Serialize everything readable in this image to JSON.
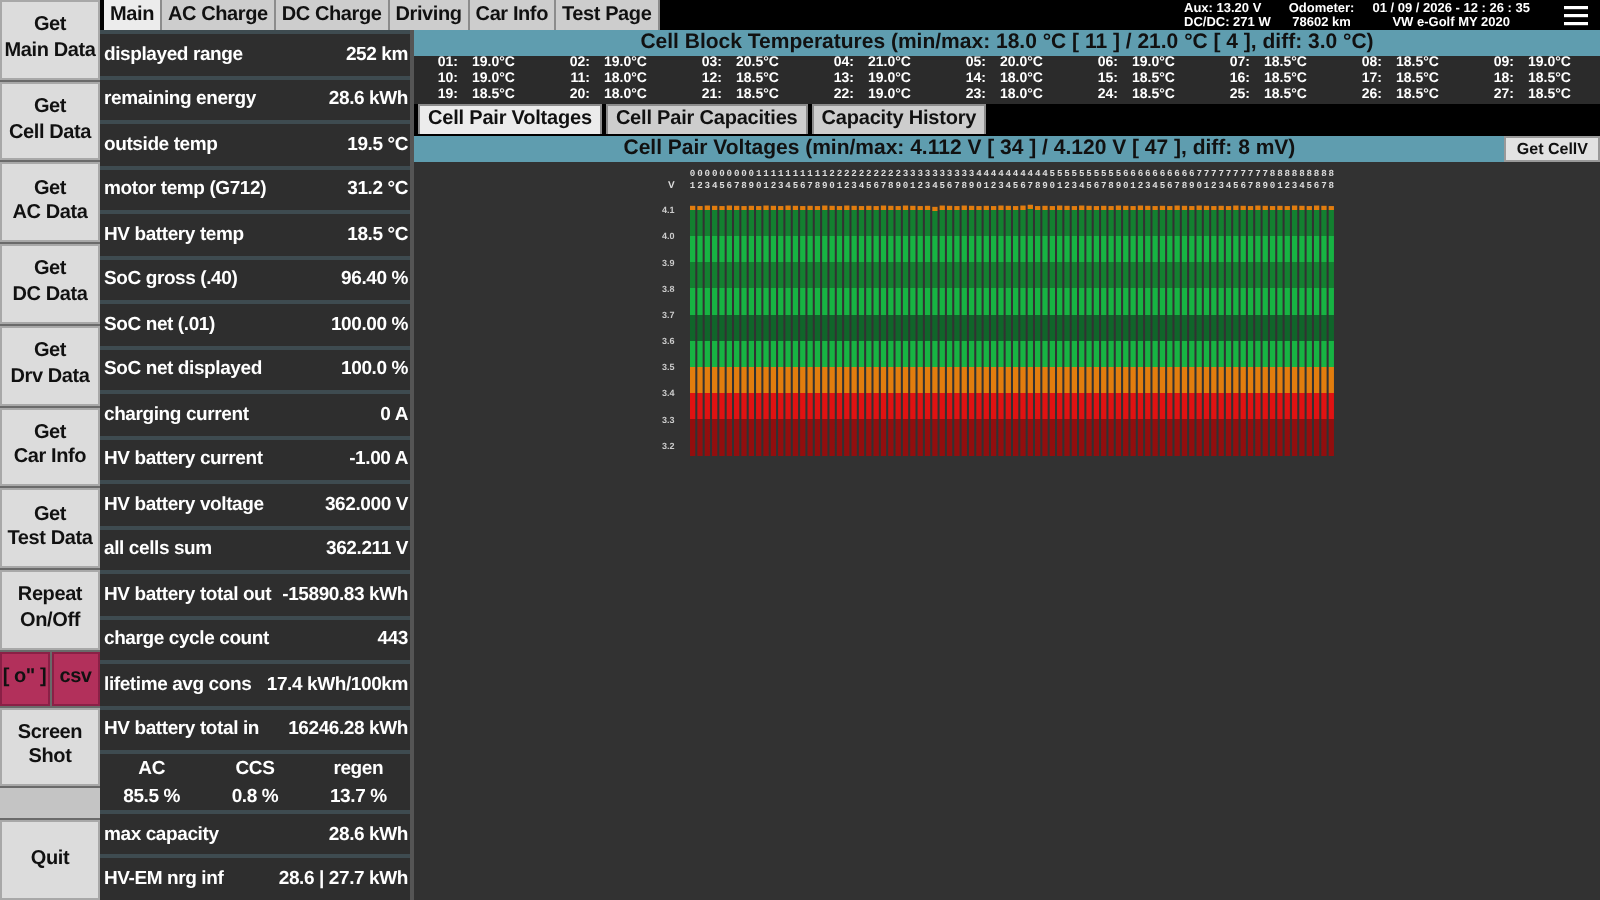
{
  "nav_buttons": [
    {
      "kind": "button",
      "lines": [
        "Get",
        "Main Data"
      ]
    },
    {
      "kind": "button",
      "lines": [
        "Get",
        "Cell Data"
      ]
    },
    {
      "kind": "button",
      "lines": [
        "Get",
        "AC Data"
      ]
    },
    {
      "kind": "button",
      "lines": [
        "Get",
        "DC Data"
      ]
    },
    {
      "kind": "button",
      "lines": [
        "Get",
        "Drv Data"
      ]
    },
    {
      "kind": "button",
      "lines": [
        "Get",
        "Car Info"
      ]
    },
    {
      "kind": "button",
      "lines": [
        "Get",
        "Test Data"
      ]
    },
    {
      "kind": "button",
      "lines": [
        "Repeat",
        "On/Off"
      ]
    },
    {
      "kind": "pair",
      "labels": [
        "[ o\" ]",
        "csv"
      ]
    },
    {
      "kind": "button",
      "lines": [
        "Screen",
        "Shot"
      ]
    },
    {
      "kind": "spacer"
    },
    {
      "kind": "button",
      "lines": [
        "Quit"
      ]
    }
  ],
  "main_tabs": [
    {
      "label": "Main",
      "selected": true
    },
    {
      "label": "AC Charge",
      "selected": false
    },
    {
      "label": "DC Charge",
      "selected": false
    },
    {
      "label": "Driving",
      "selected": false
    },
    {
      "label": "Car Info",
      "selected": false
    },
    {
      "label": "Test Page",
      "selected": false
    }
  ],
  "status": {
    "aux": "Aux: 13.20 V",
    "dcdc": "DC/DC: 271 W",
    "odometer_label": "Odometer:",
    "odometer": "78602 km",
    "datetime": "01 / 09 / 2026 - 12 : 26 : 35",
    "car_model": "VW e-Golf MY 2020"
  },
  "data_rows": [
    {
      "kind": "row",
      "label": "displayed range",
      "value": "252 km"
    },
    {
      "kind": "row",
      "label": "remaining energy",
      "value": "28.6 kWh"
    },
    {
      "kind": "row",
      "label": "outside temp",
      "value": "19.5 °C"
    },
    {
      "kind": "row",
      "label": "motor temp (G712)",
      "value": "31.2 °C"
    },
    {
      "kind": "row",
      "label": "HV battery temp",
      "value": "18.5 °C"
    },
    {
      "kind": "row",
      "label": "SoC gross (.40)",
      "value": "96.40 %"
    },
    {
      "kind": "row",
      "label": "SoC net (.01)",
      "value": "100.00 %"
    },
    {
      "kind": "row",
      "label": "SoC net displayed",
      "value": "100.0 %"
    },
    {
      "kind": "row",
      "label": "charging current",
      "value": "0 A"
    },
    {
      "kind": "row",
      "label": "HV battery current",
      "value": "-1.00 A"
    },
    {
      "kind": "row",
      "label": "HV battery voltage",
      "value": "362.000 V"
    },
    {
      "kind": "row",
      "label": "all cells sum",
      "value": "362.211 V"
    },
    {
      "kind": "row",
      "label": "HV battery total out",
      "value": "-15890.83 kWh"
    },
    {
      "kind": "row",
      "label": "charge cycle count",
      "value": "443"
    },
    {
      "kind": "row",
      "label": "lifetime avg cons",
      "value": "17.4 kWh/100km"
    },
    {
      "kind": "row",
      "label": "HV battery total in",
      "value": "16246.28 kWh"
    },
    {
      "kind": "triple",
      "columns": [
        {
          "label": "AC",
          "value": "85.5 %"
        },
        {
          "label": "CCS",
          "value": "0.8 %"
        },
        {
          "label": "regen",
          "value": "13.7 %"
        }
      ]
    },
    {
      "kind": "row",
      "label": "max capacity",
      "value": "28.6 kWh"
    },
    {
      "kind": "row",
      "label": "HV-EM nrg inf",
      "value": "28.6 | 27.7 kWh"
    }
  ],
  "temperatures": {
    "title": "Cell Block Temperatures (min/max: 18.0 °C [ 11 ] / 21.0 °C [ 4 ], diff: 3.0 °C)",
    "cells": [
      {
        "label": "01:",
        "value": "19.0°C"
      },
      {
        "label": "02:",
        "value": "19.0°C"
      },
      {
        "label": "03:",
        "value": "20.5°C"
      },
      {
        "label": "04:",
        "value": "21.0°C"
      },
      {
        "label": "05:",
        "value": "20.0°C"
      },
      {
        "label": "06:",
        "value": "19.0°C"
      },
      {
        "label": "07:",
        "value": "18.5°C"
      },
      {
        "label": "08:",
        "value": "18.5°C"
      },
      {
        "label": "09:",
        "value": "19.0°C"
      },
      {
        "label": "10:",
        "value": "19.0°C"
      },
      {
        "label": "11:",
        "value": "18.0°C"
      },
      {
        "label": "12:",
        "value": "18.5°C"
      },
      {
        "label": "13:",
        "value": "19.0°C"
      },
      {
        "label": "14:",
        "value": "18.0°C"
      },
      {
        "label": "15:",
        "value": "18.5°C"
      },
      {
        "label": "16:",
        "value": "18.5°C"
      },
      {
        "label": "17:",
        "value": "18.5°C"
      },
      {
        "label": "18:",
        "value": "18.5°C"
      },
      {
        "label": "19:",
        "value": "18.5°C"
      },
      {
        "label": "20:",
        "value": "18.0°C"
      },
      {
        "label": "21:",
        "value": "18.5°C"
      },
      {
        "label": "22:",
        "value": "19.0°C"
      },
      {
        "label": "23:",
        "value": "18.0°C"
      },
      {
        "label": "24:",
        "value": "18.5°C"
      },
      {
        "label": "25:",
        "value": "18.5°C"
      },
      {
        "label": "26:",
        "value": "18.5°C"
      },
      {
        "label": "27:",
        "value": "18.5°C"
      }
    ]
  },
  "sub_tabs": [
    {
      "label": "Cell Pair Voltages",
      "selected": true
    },
    {
      "label": "Cell Pair Capacities",
      "selected": false
    },
    {
      "label": "Capacity History",
      "selected": false
    }
  ],
  "voltage_panel": {
    "title": "Cell Pair Voltages (min/max: 4.112 V [ 34 ] / 4.120 V [ 47 ], diff: 8 mV)",
    "button": "Get CellV",
    "chart_data": {
      "type": "bar",
      "ylabel": "V",
      "ylim": [
        3.16,
        4.15
      ],
      "categories": [
        "01",
        "02",
        "03",
        "04",
        "05",
        "06",
        "07",
        "08",
        "09",
        "10",
        "11",
        "12",
        "13",
        "14",
        "15",
        "16",
        "17",
        "18",
        "19",
        "20",
        "21",
        "22",
        "23",
        "24",
        "25",
        "26",
        "27",
        "28",
        "29",
        "30",
        "31",
        "32",
        "33",
        "34",
        "35",
        "36",
        "37",
        "38",
        "39",
        "40",
        "41",
        "42",
        "43",
        "44",
        "45",
        "46",
        "47",
        "48",
        "49",
        "50",
        "51",
        "52",
        "53",
        "54",
        "55",
        "56",
        "57",
        "58",
        "59",
        "60",
        "61",
        "62",
        "63",
        "64",
        "65",
        "66",
        "67",
        "68",
        "69",
        "70",
        "71",
        "72",
        "73",
        "74",
        "75",
        "76",
        "77",
        "78",
        "79",
        "80",
        "81",
        "82",
        "83",
        "84",
        "85",
        "86",
        "87",
        "88"
      ],
      "yticks": [
        {
          "value": 4.1,
          "label": "4.1"
        },
        {
          "value": 4,
          "label": "4.0"
        },
        {
          "value": 3.9,
          "label": "3.9"
        },
        {
          "value": 3.8,
          "label": "3.8"
        },
        {
          "value": 3.7,
          "label": "3.7"
        },
        {
          "value": 3.6,
          "label": "3.6"
        },
        {
          "value": 3.5,
          "label": "3.5"
        },
        {
          "value": 3.4,
          "label": "3.4"
        },
        {
          "value": 3.3,
          "label": "3.3"
        },
        {
          "value": 3.2,
          "label": "3.2"
        }
      ],
      "values": [
        4.116,
        4.115,
        4.117,
        4.116,
        4.115,
        4.117,
        4.116,
        4.115,
        4.116,
        4.115,
        4.117,
        4.116,
        4.115,
        4.117,
        4.116,
        4.115,
        4.116,
        4.115,
        4.117,
        4.116,
        4.115,
        4.117,
        4.116,
        4.115,
        4.116,
        4.115,
        4.117,
        4.116,
        4.115,
        4.117,
        4.116,
        4.115,
        4.116,
        4.112,
        4.117,
        4.116,
        4.115,
        4.117,
        4.116,
        4.115,
        4.116,
        4.115,
        4.117,
        4.116,
        4.115,
        4.117,
        4.12,
        4.115,
        4.116,
        4.115,
        4.117,
        4.116,
        4.115,
        4.117,
        4.116,
        4.115,
        4.116,
        4.115,
        4.117,
        4.116,
        4.115,
        4.117,
        4.116,
        4.115,
        4.116,
        4.115,
        4.117,
        4.116,
        4.115,
        4.117,
        4.116,
        4.115,
        4.116,
        4.115,
        4.117,
        4.116,
        4.115,
        4.117,
        4.116,
        4.115,
        4.116,
        4.115,
        4.117,
        4.116,
        4.115,
        4.117,
        4.116,
        4.115
      ]
    }
  }
}
